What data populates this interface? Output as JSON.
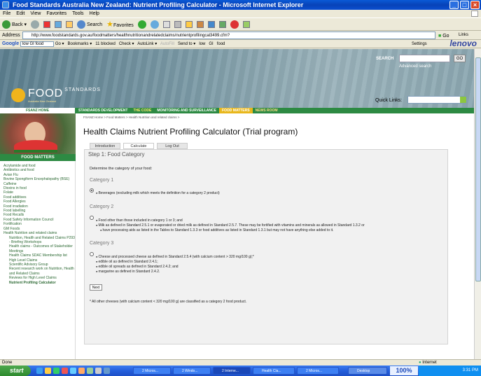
{
  "window": {
    "title": "Food Standards Australia New Zealand: Nutrient Profiling Calculator - Microsoft Internet Explorer"
  },
  "menu": [
    "File",
    "Edit",
    "View",
    "Favorites",
    "Tools",
    "Help"
  ],
  "toolbar": {
    "back": "Back",
    "search": "Search",
    "favorites": "Favorites"
  },
  "address": {
    "label": "Address",
    "url": "http://www.foodstandards.gov.au/foodmatters/healthnutritionandrelatedclaims/nutrientprofilingcal3499.cfm?",
    "go": "Go",
    "links": "Links"
  },
  "googlebar": {
    "brand": "Google",
    "query": "low GI food",
    "go": "Go",
    "bookmarks": "Bookmarks",
    "blocked": "11 blocked",
    "check": "Check",
    "autolink": "AutoLink",
    "autofill": "AutoFill",
    "sendto": "Send to",
    "term1": "low",
    "term2": "GI",
    "term3": "food",
    "settings": "Settings",
    "lenovo": "lenovo"
  },
  "header": {
    "logo": "FOOD",
    "logo_sub": "STANDARDS",
    "logo_caption": "Australia New Zealand",
    "search_label": "SEARCH",
    "search_go": "GO",
    "advanced": "Advanced search",
    "quicklinks_label": "Quick Links:",
    "quicklinks_value": ""
  },
  "nav": {
    "home": "FSANZ HOME",
    "items": [
      "STANDARDS DEVELOPMENT",
      "THE CODE",
      "MONITORING AND SURVEILLANCE",
      "FOOD MATTERS",
      "NEWS ROOM"
    ]
  },
  "sidebar": {
    "title": "FOOD MATTERS",
    "items": [
      "Acrylamide and food",
      "Antibiotics and food",
      "Avian Flu",
      "Bovine Spongiform Encephalopathy (BSE)",
      "Caffeine",
      "Dioxins in food",
      "Folate",
      "Food additives",
      "Food Allergies",
      "Food irradiation",
      "Food labelling",
      "Food Recalls",
      "Food Safety Information Council",
      "Fortification",
      "GM Foods",
      "Health Nutrition and related claims"
    ],
    "subitems": [
      "Nutrition, Health and Related Claims P293 - Briefing Workshops",
      "Health claims - Outcomes of Stakeholder Meetings",
      "Health Claims SDAC Membership list",
      "High Level Claims",
      "Scientific Advisory Group",
      "Recent research work on Nutrition, Health and Related Claims",
      "Reviews for High Level Claims",
      "Nutrient Profiling Calculator"
    ]
  },
  "main": {
    "breadcrumb": "FSANZ Home > Food Matters > Health Nutrition and related claims >",
    "title": "Health Claims Nutrient Profiling Calculator (Trial program)",
    "tabs": [
      "Introduction",
      "Calculate",
      "Log Out"
    ],
    "step": "Step 1: Food Category",
    "question": "Determine the category of your food:",
    "cat1": "Category 1",
    "cat1_opts": [
      "Beverages (excluding milk which meets the definition for a category 2 product)"
    ],
    "cat2": "Category 2",
    "cat2_opts": [
      "Food other than those included in category 1 or 3; and",
      "Milk as defined in Standard 2.5.1 or evaporated or dried milk as defined in Standard 2.5.7. These may be fortified with vitamins and minerals as allowed in Standard 1.3.2 or",
      "have processing aids as listed in the Tables to Standard 1.3.3 or food additives as listed in Standard 1.3.1 but may not have anything else added to it."
    ],
    "cat3": "Category 3",
    "cat3_opts": [
      "Cheese and processed cheese as defined in Standard 2.5.4 (with calcium content > 320 mg/100 g);*",
      "edible oil as defined in Standard 2.4.1;",
      "edible oil spreads as defined in Standard 2.4.2; and",
      "margarine as defined in Standard 2.4.2."
    ],
    "next": "Next",
    "footnote": "* All other cheeses (with calcium content < 320 mg/100 g) are classified as a category 2 food product."
  },
  "status": {
    "left": "Done",
    "zone": "Internet"
  },
  "taskbar": {
    "start": "start",
    "tasks": [
      "2 Micros...",
      "2 Windo...",
      "2 Interne...",
      "Health Cla...",
      "2 Micros...",
      "Desktop"
    ],
    "zoom": "100%",
    "clock": "3:31 PM"
  }
}
